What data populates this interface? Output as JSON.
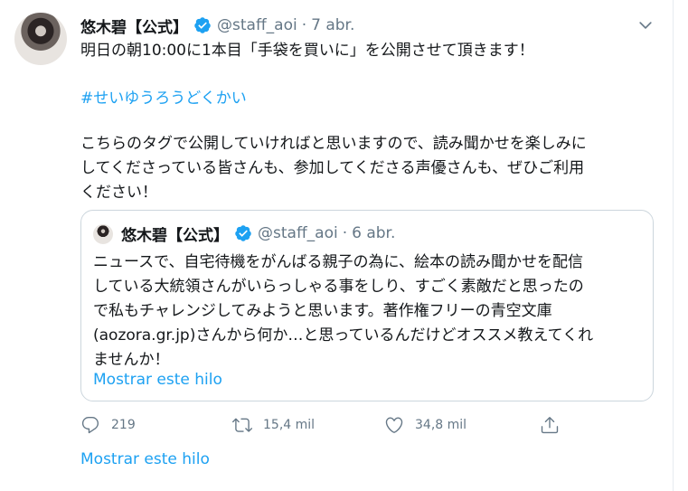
{
  "tweet": {
    "author_name": "悠木碧【公式】",
    "handle": "@staff_aoi",
    "separator": "·",
    "date": "7 abr.",
    "line1": "明日の朝10:00に1本目「手袋を買いに」を公開させて頂きます！",
    "hashtag": "#せいゆうろうどくかい",
    "body_lines": [
      "こちらのタグで公開していければと思いますので、読み聞かせを楽しみに",
      "してくださっている皆さんも、参加してくださる声優さんも、ぜひご利用",
      "ください！"
    ]
  },
  "quote": {
    "author_name": "悠木碧【公式】",
    "handle": "@staff_aoi",
    "separator": "·",
    "date": "6 abr.",
    "lines": [
      "ニュースで、自宅待機をがんばる親子の為に、絵本の読み聞かせを配信",
      "している大統領さんがいらっしゃる事をしり、すごく素敵だと思ったの",
      "で私もチャレンジしてみようと思います。著作権フリーの青空文庫",
      "(aozora.gr.jp)さんから何か…と思っているんだけどオススメ教えてくれ",
      "ませんか！"
    ],
    "show_thread": "Mostrar este hilo"
  },
  "actions": {
    "replies": "219",
    "retweets": "15,4 mil",
    "likes": "34,8 mil"
  },
  "show_thread": "Mostrar este hilo",
  "colors": {
    "accent": "#1da1f2",
    "muted": "#657786",
    "border": "#ccd6dd"
  }
}
